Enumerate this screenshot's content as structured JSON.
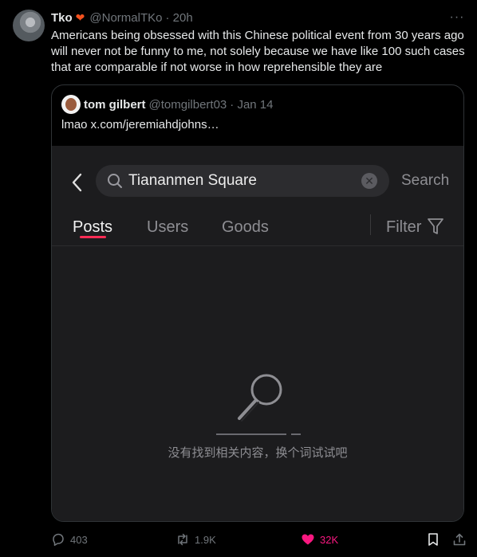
{
  "tweet": {
    "author_name": "Tko",
    "author_handle": "@NormalTKo",
    "time": "· 20h",
    "text": "Americans being obsessed with this Chinese political event from 30 years ago will never not be funny to me, not solely because we have like 100 such cases that are comparable if not worse in how reprehensible they are",
    "more_label": "···",
    "name_emoji_icon": "fire-heart-emoji-icon"
  },
  "quote": {
    "author_name": "tom gilbert",
    "author_handle": "@tomgilbert03",
    "time": "· Jan 14",
    "text": "lmao  x.com/jeremiahdjohns…"
  },
  "screenshot": {
    "search_query": "Tiananmen Square",
    "search_button": "Search",
    "tabs": [
      "Posts",
      "Users",
      "Goods"
    ],
    "active_tab": "Posts",
    "filter_label": "Filter",
    "empty_message": "没有找到相关内容，换个词试试吧",
    "accent_color": "#fe2c55"
  },
  "actions": {
    "replies": "403",
    "reposts": "1.9K",
    "likes": "32K",
    "like_color": "#f91880"
  }
}
